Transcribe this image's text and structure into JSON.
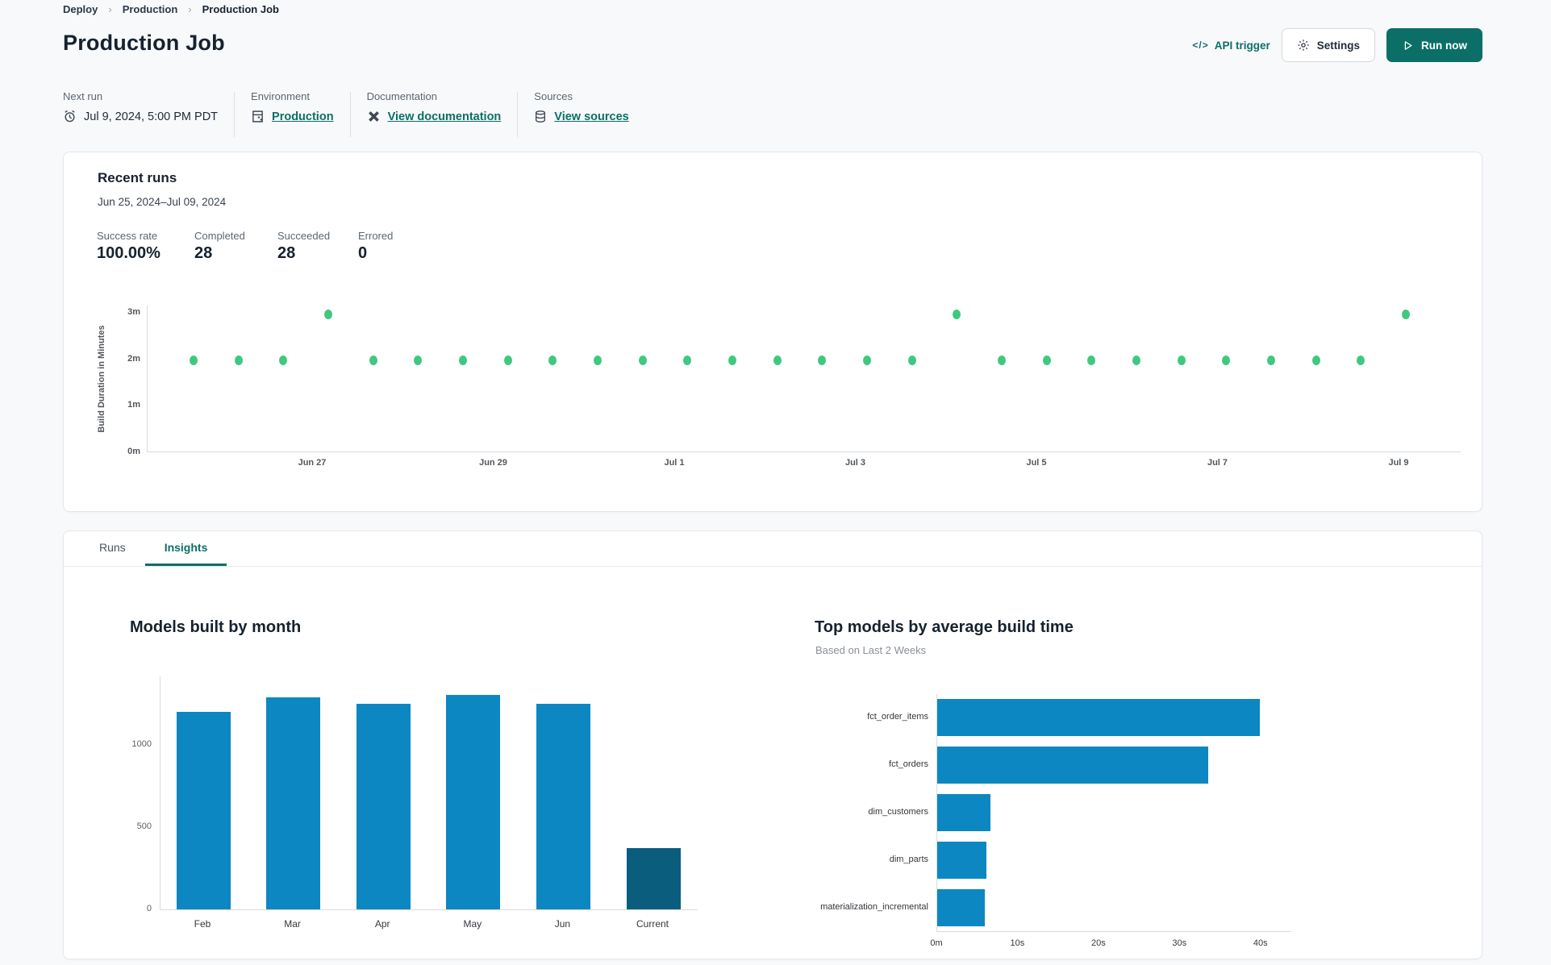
{
  "breadcrumb": {
    "items": [
      "Deploy",
      "Production",
      "Production Job"
    ]
  },
  "header": {
    "title": "Production Job",
    "api_trigger_label": "API trigger",
    "api_trigger_glyph": "</>",
    "settings_label": "Settings",
    "run_now_label": "Run now"
  },
  "info": {
    "next_run": {
      "label": "Next run",
      "value": "Jul 9, 2024, 5:00 PM PDT",
      "icon": "alarm-clock-icon"
    },
    "environment": {
      "label": "Environment",
      "link": "Production",
      "icon": "environment-icon"
    },
    "documentation": {
      "label": "Documentation",
      "link": "View documentation",
      "icon": "dbt-logo-icon"
    },
    "sources": {
      "label": "Sources",
      "link": "View sources",
      "icon": "database-icon"
    }
  },
  "recent_runs": {
    "title": "Recent runs",
    "date_range": "Jun 25, 2024–Jul 09, 2024",
    "stats": [
      {
        "label": "Success rate",
        "value": "100.00%"
      },
      {
        "label": "Completed",
        "value": "28"
      },
      {
        "label": "Succeeded",
        "value": "28"
      },
      {
        "label": "Errored",
        "value": "0"
      }
    ]
  },
  "tabs": [
    {
      "label": "Runs",
      "active": false
    },
    {
      "label": "Insights",
      "active": true
    }
  ],
  "colors": {
    "accent_teal": "#0b6f67",
    "dot_green": "#3fc97e",
    "bar_blue": "#0d87c1",
    "bar_navy": "#0b5d7e"
  },
  "chart_data": [
    {
      "type": "scatter",
      "title": "Recent runs build duration",
      "ylabel": "Build Duration in Minutes",
      "yticks": [
        "0m",
        "1m",
        "2m",
        "3m"
      ],
      "ylim": [
        0,
        3.15
      ],
      "xticks": [
        "Jun 27",
        "Jun 29",
        "Jul 1",
        "Jul 3",
        "Jul 5",
        "Jul 7",
        "Jul 9"
      ],
      "grid": false,
      "point_color": "#3fc97e",
      "points_minutes": [
        1.98,
        1.98,
        1.98,
        2.97,
        1.98,
        1.98,
        1.98,
        1.98,
        1.98,
        1.98,
        1.98,
        1.98,
        1.98,
        1.98,
        1.98,
        1.98,
        1.98,
        2.97,
        1.98,
        1.98,
        1.98,
        1.98,
        1.98,
        1.98,
        1.98,
        1.98,
        1.98,
        2.97
      ]
    },
    {
      "type": "bar",
      "title": "Models built by month",
      "categories": [
        "Feb",
        "Mar",
        "Apr",
        "May",
        "Jun",
        "Current"
      ],
      "values": [
        1200,
        1290,
        1250,
        1305,
        1250,
        375
      ],
      "yticks": [
        0,
        500,
        1000
      ],
      "ylim": [
        0,
        1422
      ],
      "grid": false,
      "bar_color": "#0d87c1",
      "current_bar_color": "#0b5d7e"
    },
    {
      "type": "bar-horizontal",
      "title": "Top models by average build time",
      "subtitle": "Based on Last 2 Weeks",
      "categories": [
        "fct_order_items",
        "fct_orders",
        "dim_customers",
        "dim_parts",
        "materialization_incremental"
      ],
      "values_seconds": [
        39.8,
        33.4,
        6.6,
        6.1,
        5.9
      ],
      "xticks": [
        "0m",
        "10s",
        "20s",
        "30s",
        "40s"
      ],
      "xlim": [
        0,
        43.8
      ],
      "grid": false,
      "bar_color": "#0d87c1"
    }
  ]
}
